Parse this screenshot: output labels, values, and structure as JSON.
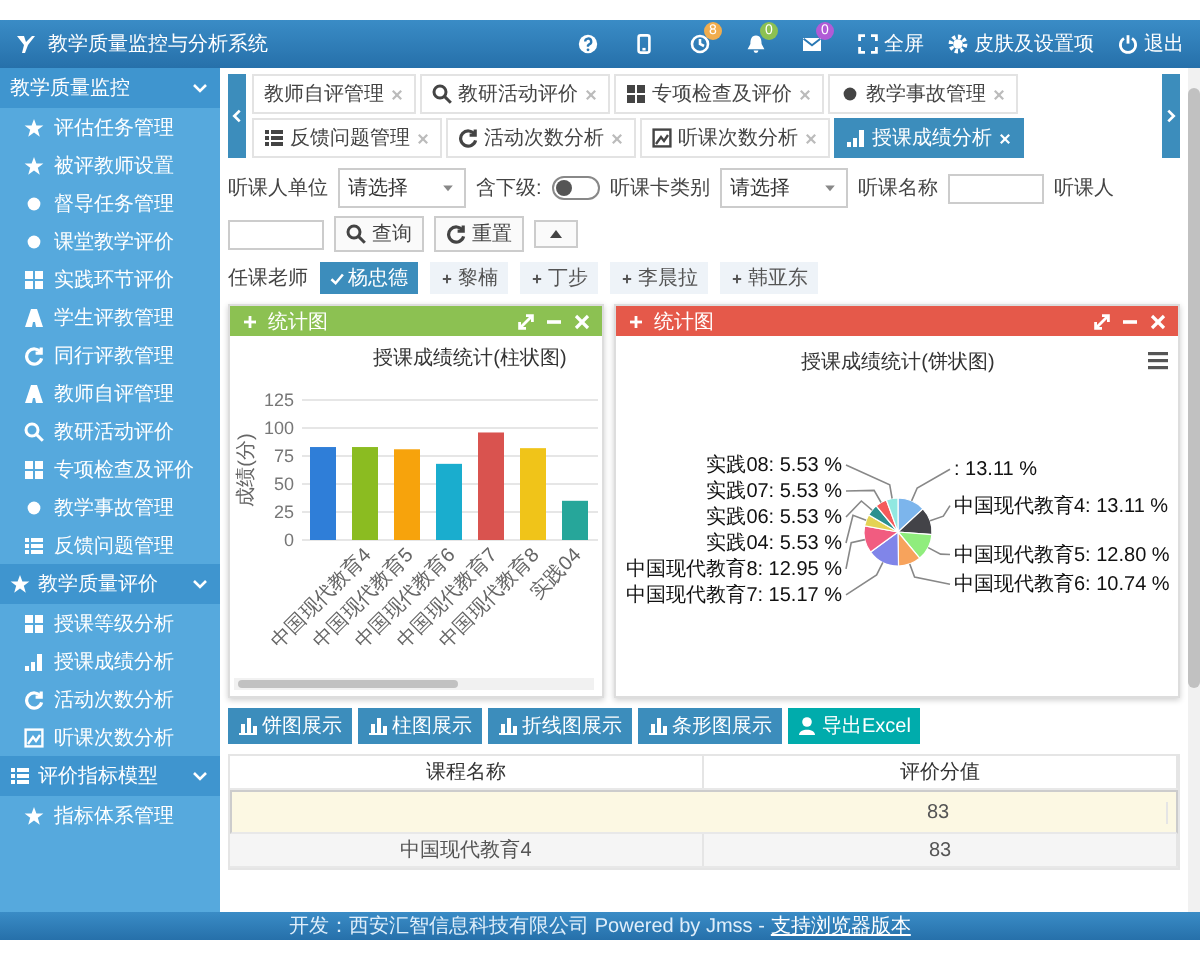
{
  "window": {
    "title": "教学质量监控与分析系统"
  },
  "header": {
    "icons": [
      {
        "kind": "help"
      },
      {
        "kind": "phone"
      },
      {
        "kind": "clock",
        "badge": "8",
        "color": "#f0ad4e"
      },
      {
        "kind": "bell",
        "badge": "0",
        "color": "#8cc152"
      },
      {
        "kind": "mail",
        "badge": "0",
        "color": "#b15bd6"
      }
    ],
    "links": [
      {
        "kind": "fullscreen",
        "label": "全屏"
      },
      {
        "kind": "gear",
        "label": "皮肤及设置项"
      },
      {
        "kind": "power",
        "label": "退出"
      }
    ]
  },
  "sidebar": {
    "groups": [
      {
        "label": "教学质量监控",
        "expanded": true,
        "children": [
          {
            "label": "评估任务管理"
          },
          {
            "label": "被评教师设置"
          },
          {
            "label": "督导任务管理"
          },
          {
            "label": "课堂教学评价"
          },
          {
            "label": "实践环节评价"
          },
          {
            "label": "学生评教管理"
          },
          {
            "label": "同行评教管理"
          },
          {
            "label": "教师自评管理"
          },
          {
            "label": "教研活动评价"
          },
          {
            "label": "专项检查及评价"
          },
          {
            "label": "教学事故管理"
          },
          {
            "label": "反馈问题管理"
          }
        ]
      },
      {
        "label": "教学质量评价",
        "expanded": true,
        "children": [
          {
            "label": "授课等级分析"
          },
          {
            "label": "授课成绩分析"
          },
          {
            "label": "活动次数分析"
          },
          {
            "label": "听课次数分析"
          }
        ]
      },
      {
        "label": "评价指标模型",
        "expanded": true,
        "children": [
          {
            "label": "指标体系管理"
          }
        ]
      }
    ]
  },
  "tabs": [
    {
      "label": "教师自评管理",
      "selected": false
    },
    {
      "label": "教研活动评价",
      "selected": false
    },
    {
      "label": "专项检查及评价",
      "selected": false
    },
    {
      "label": "教学事故管理",
      "selected": false
    },
    {
      "label": "反馈问题管理",
      "selected": false
    },
    {
      "label": "活动次数分析",
      "selected": false
    },
    {
      "label": "听课次数分析",
      "selected": false
    },
    {
      "label": "授课成绩分析",
      "selected": true
    }
  ],
  "filters": {
    "unit": {
      "label": "听课人单位",
      "value": "请选择"
    },
    "include_sub": {
      "label": "含下级:",
      "on": false
    },
    "card_type": {
      "label": "听课卡类别",
      "value": "请选择"
    },
    "course_name": {
      "label": "听课名称"
    },
    "listener": {
      "label": "听课人"
    },
    "buttons": [
      {
        "kind": "search",
        "label": "查询"
      },
      {
        "kind": "reset",
        "label": "重置"
      },
      {
        "kind": "collapse"
      }
    ]
  },
  "teachers": {
    "label": "任课老师",
    "chips": [
      {
        "label": "杨忠德",
        "selected": true
      },
      {
        "label": "黎楠",
        "selected": false
      },
      {
        "label": "丁步",
        "selected": false
      },
      {
        "label": "李晨拉",
        "selected": false
      },
      {
        "label": "韩亚东",
        "selected": false
      }
    ]
  },
  "panels": [
    {
      "title": "统计图",
      "color": "#8cc152",
      "chart_data": {
        "type": "bar",
        "title": "授课成绩统计(柱状图)",
        "ylabel": "成绩(分)",
        "categories": [
          null,
          "中国现代教育4",
          "中国现代教育5",
          "中国现代教育6",
          "中国现代教育7",
          "中国现代教育8",
          "实践04"
        ],
        "series": [
          {
            "values": [
              83,
              83,
              81,
              68,
              96,
              82,
              35
            ]
          }
        ],
        "colors": [
          "#2f7ed8",
          "#8bbc21",
          "#f7a30c",
          "#1aadce",
          "#d9534f",
          "#f0c419",
          "#26a69a"
        ],
        "ylim": [
          0,
          125
        ],
        "yticks": [
          0,
          25,
          50,
          75,
          100,
          125
        ],
        "grid": true
      }
    },
    {
      "title": "统计图",
      "color": "#e5594a",
      "chart_data": {
        "type": "pie",
        "title": "授课成绩统计(饼状图)",
        "values": [
          13.11,
          13.11,
          12.8,
          10.74,
          15.17,
          12.95,
          5.53,
          5.53,
          5.53,
          5.53
        ],
        "colors": [
          "#7cb5ec",
          "#434348",
          "#90ed7d",
          "#f7a35c",
          "#8085e9",
          "#f15c80",
          "#e4d354",
          "#2b908f",
          "#f45b5b",
          "#91e8e1"
        ],
        "value_labels": [
          ": 13.11 %",
          "中国现代教育4: 13.11 %",
          "中国现代教育5: 12.80 %",
          "中国现代教育6: 10.74 %",
          "中国现代教育7: 15.17 %",
          "中国现代教育8: 12.95 %",
          "实践04: 5.53 %",
          "实践06: 5.53 %",
          "实践07: 5.53 %",
          "实践08: 5.53 %"
        ]
      }
    }
  ],
  "actions": [
    {
      "kind": "chart",
      "label": "饼图展示"
    },
    {
      "kind": "chart",
      "label": "柱图展示"
    },
    {
      "kind": "chart",
      "label": "折线图展示"
    },
    {
      "kind": "chart",
      "label": "条形图展示"
    },
    {
      "kind": "export",
      "label": "导出Excel"
    }
  ],
  "table": {
    "columns": [
      "课程名称",
      "评价分值"
    ],
    "rows": [
      {
        "score": "83",
        "selected": true
      },
      {
        "course": "中国现代教育4",
        "score": "83",
        "selected": false
      }
    ]
  },
  "footer": {
    "text": "开发：西安汇智信息科技有限公司 Powered by Jmss -",
    "link": "支持浏览器版本"
  }
}
